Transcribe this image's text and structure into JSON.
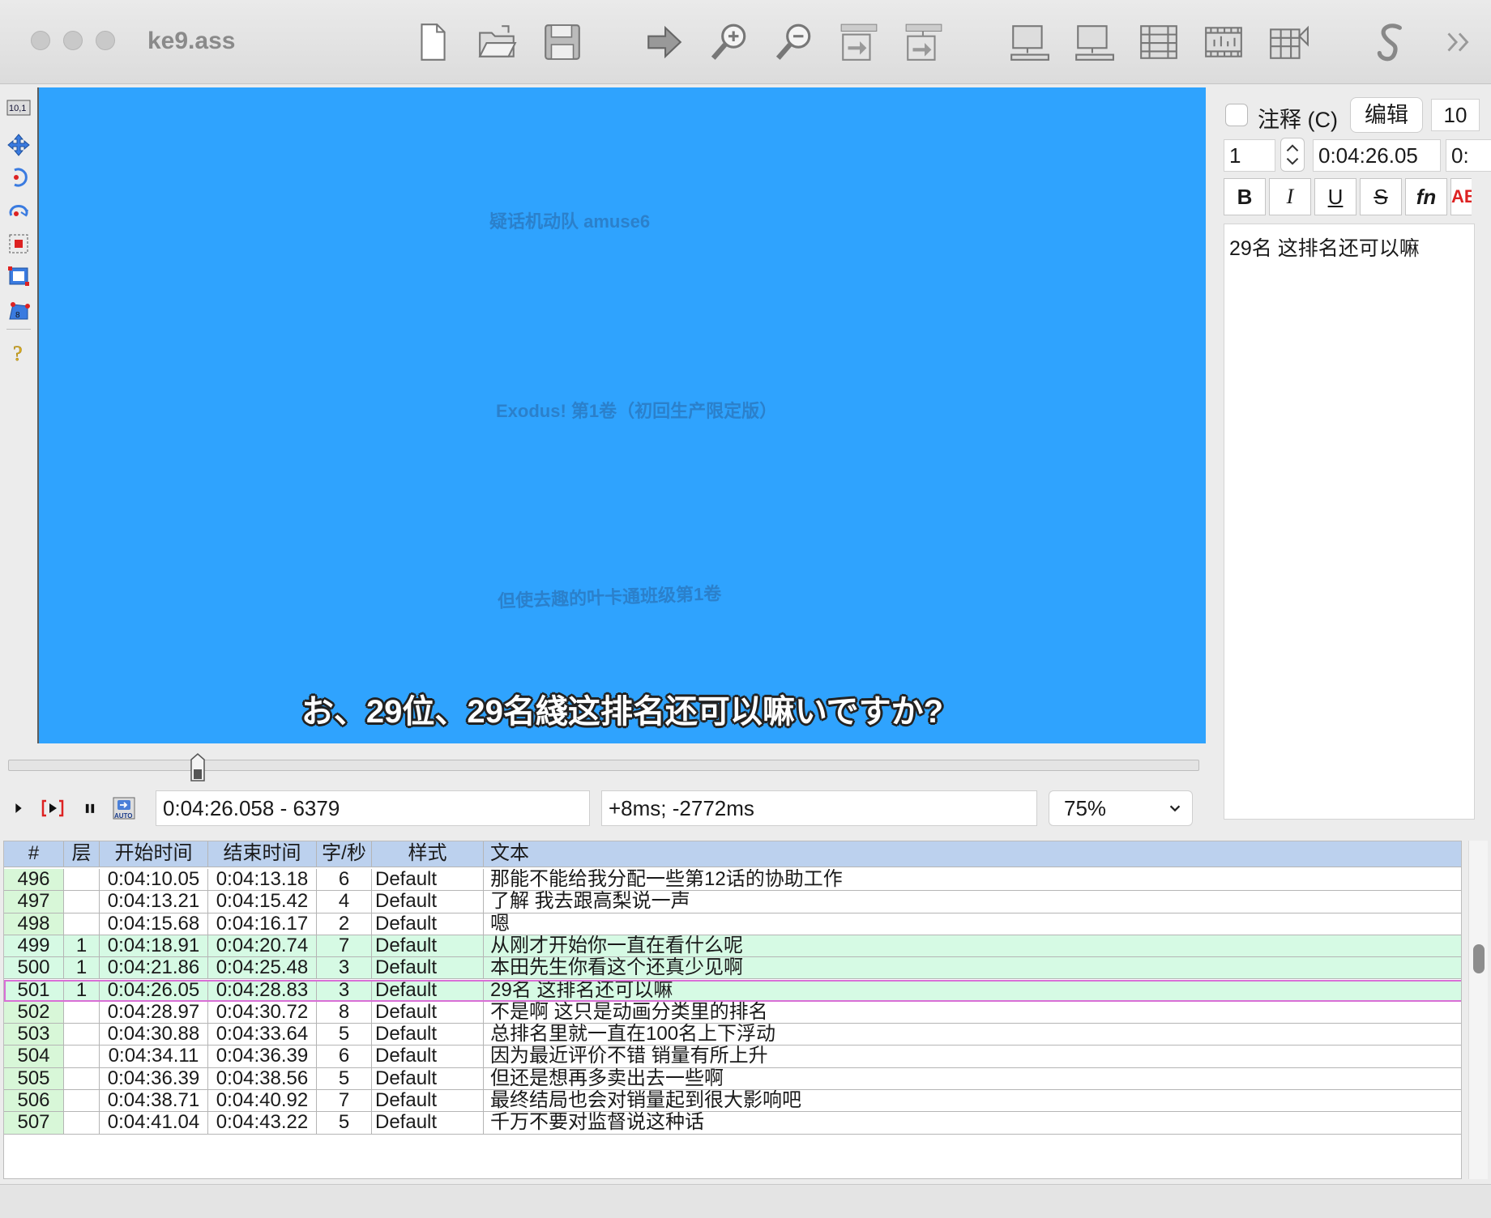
{
  "window": {
    "title": "ke9.ass"
  },
  "toolbar": {
    "icons": [
      "new-file-icon",
      "open-folder-icon",
      "save-icon",
      "jump-to-icon",
      "zoom-in-icon",
      "zoom-out-icon",
      "snap-start-icon",
      "snap-end-icon",
      "video-display-icon",
      "audio-display-icon",
      "subtitle-grid-icon",
      "frame-timeline-icon",
      "keyframe-icon",
      "script-icon",
      "overflow-chevron-icon"
    ]
  },
  "video": {
    "overlay_texts": [
      "疑话机动队 amuse6",
      "Exodus! 第1卷（初回生产限定版）",
      "但使去趣的叶卡通班级第1卷"
    ],
    "subtitle": "お、29位、29名綫这排名还可以嘛いですか?"
  },
  "controls": {
    "position": "0:04:26.058 - 6379",
    "offset": "+8ms; -2772ms",
    "zoom": "75%"
  },
  "edit_panel": {
    "comment_label": "注释 (C)",
    "edit_button": "编辑",
    "margin_value": "10",
    "layer_value": "1",
    "start_time": "0:04:26.05",
    "end_time_partial": "0:",
    "format_buttons": {
      "bold": "B",
      "italic": "I",
      "underline": "U",
      "strike": "S",
      "font": "fn",
      "color": "AB"
    },
    "text": "29名  这排名还可以嘛"
  },
  "grid": {
    "headers": {
      "num": "#",
      "layer": "层",
      "start": "开始时间",
      "end": "结束时间",
      "cps": "字/秒",
      "style": "样式",
      "text": "文本"
    },
    "rows": [
      {
        "num": "496",
        "layer": "",
        "start": "0:04:10.05",
        "end": "0:04:13.18",
        "cps": "6",
        "style": "Default",
        "text": "那能不能给我分配一些第12话的协助工作"
      },
      {
        "num": "497",
        "layer": "",
        "start": "0:04:13.21",
        "end": "0:04:15.42",
        "cps": "4",
        "style": "Default",
        "text": "了解  我去跟高梨说一声"
      },
      {
        "num": "498",
        "layer": "",
        "start": "0:04:15.68",
        "end": "0:04:16.17",
        "cps": "2",
        "style": "Default",
        "text": "嗯"
      },
      {
        "num": "499",
        "layer": "1",
        "start": "0:04:18.91",
        "end": "0:04:20.74",
        "cps": "7",
        "style": "Default",
        "text": "从刚才开始你一直在看什么呢"
      },
      {
        "num": "500",
        "layer": "1",
        "start": "0:04:21.86",
        "end": "0:04:25.48",
        "cps": "3",
        "style": "Default",
        "text": "本田先生你看这个还真少见啊"
      },
      {
        "num": "501",
        "layer": "1",
        "start": "0:04:26.05",
        "end": "0:04:28.83",
        "cps": "3",
        "style": "Default",
        "text": "29名  这排名还可以嘛"
      },
      {
        "num": "502",
        "layer": "",
        "start": "0:04:28.97",
        "end": "0:04:30.72",
        "cps": "8",
        "style": "Default",
        "text": "不是啊  这只是动画分类里的排名"
      },
      {
        "num": "503",
        "layer": "",
        "start": "0:04:30.88",
        "end": "0:04:33.64",
        "cps": "5",
        "style": "Default",
        "text": "总排名里就一直在100名上下浮动"
      },
      {
        "num": "504",
        "layer": "",
        "start": "0:04:34.11",
        "end": "0:04:36.39",
        "cps": "6",
        "style": "Default",
        "text": "因为最近评价不错  销量有所上升"
      },
      {
        "num": "505",
        "layer": "",
        "start": "0:04:36.39",
        "end": "0:04:38.56",
        "cps": "5",
        "style": "Default",
        "text": "但还是想再多卖出去一些啊"
      },
      {
        "num": "506",
        "layer": "",
        "start": "0:04:38.71",
        "end": "0:04:40.92",
        "cps": "7",
        "style": "Default",
        "text": "最终结局也会对销量起到很大影响吧"
      },
      {
        "num": "507",
        "layer": "",
        "start": "0:04:41.04",
        "end": "0:04:43.22",
        "cps": "5",
        "style": "Default",
        "text": "千万不要对监督说这种话"
      }
    ]
  },
  "colors": {
    "video_bg": "#2fa3fe",
    "grid_header": "#bcd1ee",
    "row_number_bg": "#d8f7d8",
    "layer_row_bg": "#d6fae4",
    "active_row_border": "#d96fd6"
  }
}
